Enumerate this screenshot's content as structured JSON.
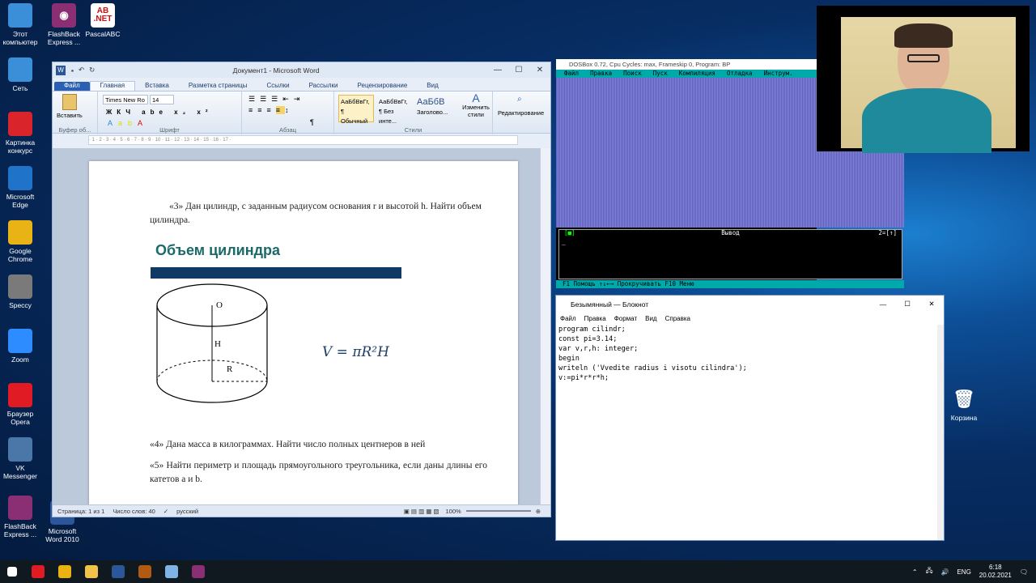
{
  "desktop": {
    "icons_left": [
      {
        "label": "Этот компьютер",
        "icon": "computer-icon",
        "color": "#3b8fd9"
      },
      {
        "label": "Сеть",
        "icon": "network-icon",
        "color": "#3b8fd9"
      },
      {
        "label": "Картинка конкурс",
        "icon": "picture-icon",
        "color": "#d8242a"
      },
      {
        "label": "Microsoft Edge",
        "icon": "edge-icon",
        "color": "#1f73c9"
      },
      {
        "label": "Google Chrome",
        "icon": "chrome-icon",
        "color": "#e9b215"
      },
      {
        "label": "Speccy",
        "icon": "speccy-icon",
        "color": "#7a7a7a"
      },
      {
        "label": "Zoom",
        "icon": "zoom-icon",
        "color": "#2d8cff"
      },
      {
        "label": "Браузер Opera",
        "icon": "opera-icon",
        "color": "#e01b24"
      },
      {
        "label": "VK Messenger",
        "icon": "vk-icon",
        "color": "#4a76a8"
      },
      {
        "label": "FlashBack Express ...",
        "icon": "flashback-icon",
        "color": "#8a2f73"
      }
    ],
    "icons_second": [
      {
        "label": "FlashBack Express ...",
        "icon": "flashback-icon",
        "color": "#8a2f73"
      },
      {
        "label": "PascalABC",
        "icon": "pascalabc-icon",
        "color": "#ffffff"
      },
      {
        "label": "Microsoft Word 2010",
        "icon": "word-icon",
        "color": "#2b579a"
      }
    ],
    "recycle_bin": "Корзина"
  },
  "word": {
    "title": "Документ1 - Microsoft Word",
    "tabs": [
      "Файл",
      "Главная",
      "Вставка",
      "Разметка страницы",
      "Ссылки",
      "Рассылки",
      "Рецензирование",
      "Вид"
    ],
    "font_name": "Times New Ro",
    "font_size": "14",
    "groups": {
      "clipboard": "Буфер об...",
      "font": "Шрифт",
      "paragraph": "Абзац",
      "styles": "Стили",
      "editing": "Редактирование"
    },
    "paste_label": "Вставить",
    "styles": [
      {
        "sample": "АаБбВвГг,",
        "name": "¶ Обычный"
      },
      {
        "sample": "АаБбВвГг,",
        "name": "¶ Без инте..."
      },
      {
        "sample": "АаБбВ",
        "name": "Заголово..."
      }
    ],
    "change_styles": "Изменить стили",
    "editing_label": "Редактирование",
    "doc": {
      "task3": "«3» Дан цилиндр, с заданным радиусом основания r и высотой h. Найти объем цилиндра.",
      "heading": "Объем цилиндра",
      "label_o": "O",
      "label_h": "H",
      "label_r": "R",
      "formula": "V = πR²H",
      "task4": "«4» Дана масса в килограммах. Найти число полных центнеров в ней",
      "task5": "«5» Найти периметр и площадь прямоугольного треугольника, если даны длины его катетов a и b."
    },
    "status": {
      "page": "Страница: 1 из 1",
      "words": "Число слов: 40",
      "lang": "русский",
      "zoom": "100%"
    }
  },
  "dosbox": {
    "title": "DOSBox 0.72, Cpu Cycles:      max, Frameskip  0, Program:     BP",
    "menu": [
      "Файл",
      "Правка",
      "Поиск",
      "Пуск",
      "Компиляция",
      "Отладка",
      "Инструм."
    ],
    "output_title": "Вывод",
    "output_left": "[■]",
    "output_right": "2=[↑]",
    "status": "F1 Помощь  ↑↓←→ Прокручивать  F10 Меню"
  },
  "notepad": {
    "title": "Безымянный — Блокнот",
    "menu": [
      "Файл",
      "Правка",
      "Формат",
      "Вид",
      "Справка"
    ],
    "code": "program cilindr;\nconst pi=3.14;\nvar v,r,h: integer;\nbegin\nwriteln ('Vvedite radius i visotu cilindra');\nv:=pi*r*r*h;"
  },
  "taskbar": {
    "lang": "ENG",
    "time": "6:18",
    "date": "20.02.2021",
    "apps": [
      {
        "icon": "windows-start-icon",
        "color": "#ffffff"
      },
      {
        "icon": "opera-icon",
        "color": "#e01b24"
      },
      {
        "icon": "chrome-icon",
        "color": "#e9b215"
      },
      {
        "icon": "explorer-icon",
        "color": "#f2c24a"
      },
      {
        "icon": "word-icon",
        "color": "#2b579a"
      },
      {
        "icon": "dosbox-icon",
        "color": "#b05a14"
      },
      {
        "icon": "notepad-icon",
        "color": "#7fb3e6"
      },
      {
        "icon": "flashback-icon",
        "color": "#8a2f73"
      }
    ]
  }
}
